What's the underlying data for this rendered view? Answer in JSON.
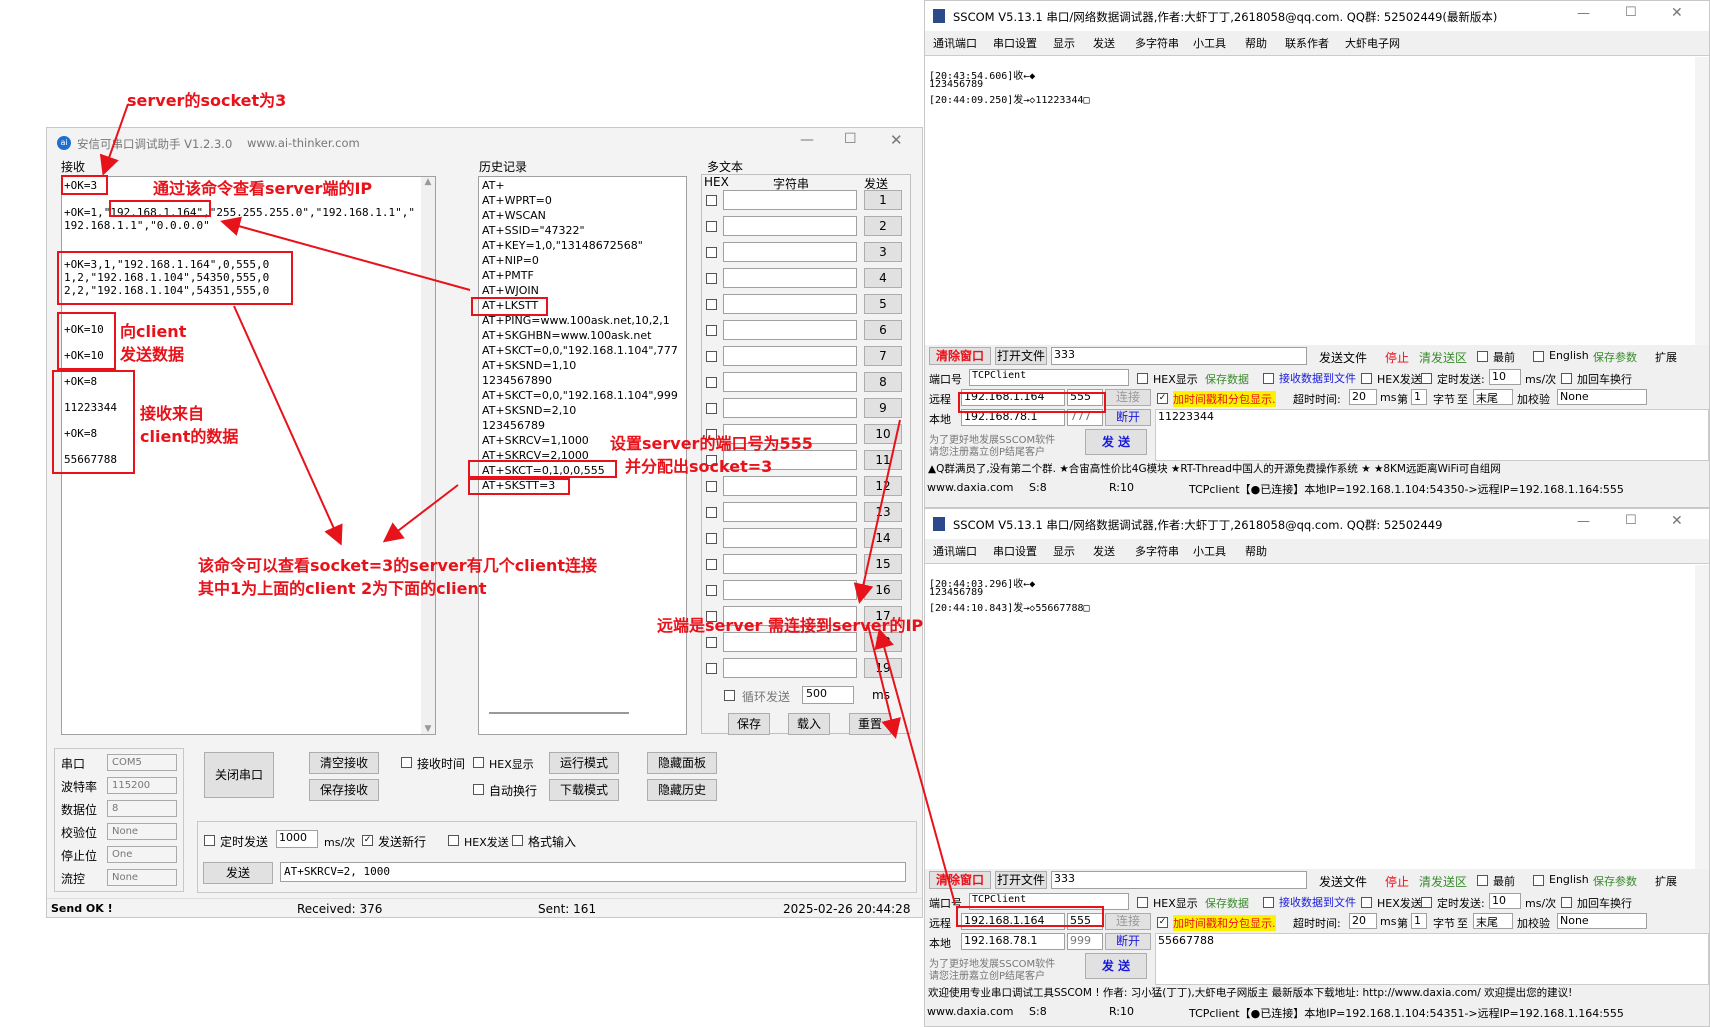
{
  "annotations": {
    "server_socket": "server的socket为3",
    "query_ip": "通过该命令查看server端的IP",
    "send_client_1": "向client",
    "send_client_2": "发送数据",
    "recv_client_1": "接收来自",
    "recv_client_2": "client的数据",
    "set_port_1": "设置server的端口号为555",
    "set_port_2": "并分配出socket=3",
    "lkstt_1": "该命令可以查看socket=3的server有几个client连接",
    "lkstt_2": "其中1为上面的client 2为下面的client",
    "remote_note": "远端是server 需连接到server的IP"
  },
  "aithinker": {
    "title": "安信可串口调试助手 V1.2.3.0",
    "url": "www.ai-thinker.com",
    "recv_label": "接收",
    "recv_lines": [
      "+OK=3",
      "+OK=1,\"192.168.1.164\",\"255.255.255.0\",\"192.168.1.1\",\"",
      "192.168.1.1\",\"0.0.0.0\"",
      "+OK=3,1,\"192.168.1.164\",0,555,0",
      "1,2,\"192.168.1.104\",54350,555,0",
      "2,2,\"192.168.1.104\",54351,555,0",
      "+OK=10",
      "+OK=10",
      "+OK=8",
      "11223344",
      "+OK=8",
      "55667788"
    ],
    "history_label": "历史记录",
    "history": [
      "AT+",
      "AT+WPRT=0",
      "AT+WSCAN",
      "AT+SSID=\"47322\"",
      "AT+KEY=1,0,\"13148672568\"",
      "AT+NIP=0",
      "AT+PMTF",
      "AT+WJOIN",
      "AT+LKSTT",
      "AT+PING=www.100ask.net,10,2,1",
      "AT+SKGHBN=www.100ask.net",
      "AT+SKCT=0,0,\"192.168.1.104\",777",
      "AT+SKSND=1,10",
      "1234567890",
      "AT+SKCT=0,0,\"192.168.1.104\",999",
      "AT+SKSND=2,10",
      "123456789",
      "AT+SKRCV=1,1000",
      "AT+SKRCV=2,1000",
      "AT+SKCT=0,1,0,0,555",
      "AT+SKSTT=3"
    ],
    "multi_label": "多文本",
    "hex_label": "HEX",
    "str_label": "字符串",
    "send_label": "发送",
    "multi_nums": [
      "1",
      "2",
      "3",
      "4",
      "5",
      "6",
      "7",
      "8",
      "9",
      "10",
      "11",
      "12",
      "13",
      "14",
      "15",
      "16",
      "17",
      "18",
      "19"
    ],
    "loop_label": "循环发送",
    "loop_value": "500",
    "ms_label": "ms",
    "save": "保存",
    "load": "载入",
    "reset": "重置",
    "port_label": "串口",
    "port_value": "COM5",
    "baud_label": "波特率",
    "baud_value": "115200",
    "data_label": "数据位",
    "data_value": "8",
    "parity_label": "校验位",
    "parity_value": "None",
    "stop_label": "停止位",
    "stop_value": "One",
    "flow_label": "流控",
    "flow_value": "None",
    "close_port": "关闭串口",
    "clear_recv": "清空接收",
    "save_recv": "保存接收",
    "recv_time": "接收时间",
    "hex_show": "HEX显示",
    "run_mode": "运行模式",
    "hide_panel": "隐藏面板",
    "auto_wrap": "自动换行",
    "dl_mode": "下载模式",
    "hide_history": "隐藏历史",
    "timed_send": "定时发送",
    "timed_value": "1000",
    "ms_per": "ms/次",
    "send_newline": "发送新行",
    "hex_send": "HEX发送",
    "fmt_input": "格式输入",
    "send_btn": "发送",
    "send_value": "AT+SKRCV=2, 1000",
    "status_send": "Send OK !",
    "status_recv": "Received: 376",
    "status_sent": "Sent: 161",
    "status_time": "2025-02-26 20:44:28"
  },
  "sscom1": {
    "title": "SSCOM V5.13.1 串口/网络数据调试器,作者:大虾丁丁,2618058@qq.com. QQ群: 52502449(最新版本)",
    "menu": [
      "通讯端口",
      "串口设置",
      "显示",
      "发送",
      "多字符串",
      "小工具",
      "帮助",
      "联系作者",
      "大虾电子网"
    ],
    "log": [
      "[20:43:54.606]收←◆",
      "123456789",
      "[20:44:09.250]发→◇11223344□"
    ],
    "send_text": "11223344",
    "remote_ip": "192.168.1.164",
    "remote_port": "555",
    "local_ip": "192.168.78.1",
    "local_port": "777",
    "connect": "连接",
    "disconnect": "断开",
    "ad": "▲Q群满员了,没有第二个群. ★合宙高性价比4G模块 ★RT-Thread中国人的开源免费操作系统 ★ ★8KM远距离WiFi可自组网",
    "status": [
      "www.daxia.com",
      "S:8",
      "R:10",
      "TCPclient【●已连接】本地IP=192.168.1.104:54350->远程IP=192.168.1.164:555"
    ]
  },
  "sscom2": {
    "title": "SSCOM V5.13.1 串口/网络数据调试器,作者:大虾丁丁,2618058@qq.com. QQ群: 52502449",
    "menu": [
      "通讯端口",
      "串口设置",
      "显示",
      "发送",
      "多字符串",
      "小工具",
      "帮助"
    ],
    "log": [
      "[20:44:03.296]收←◆",
      "123456789",
      "[20:44:10.843]发→◇55667788□"
    ],
    "send_text": "55667788",
    "remote_ip": "192.168.1.164",
    "remote_port": "555",
    "local_ip": "192.168.78.1",
    "local_port": "999",
    "connect": "连接",
    "disconnect": "断开",
    "ad": "欢迎使用专业串口调试工具SSCOM ! 作者: 习小猛(丁丁),大虾电子网版主 最新版本下载地址: http://www.daxia.com/ 欢迎提出您的建议!",
    "status": [
      "www.daxia.com",
      "S:8",
      "R:10",
      "TCPclient【●已连接】本地IP=192.168.1.104:54351->远程IP=192.168.1.164:555"
    ]
  },
  "sscom_common": {
    "clear": "清除窗口",
    "open_file": "打开文件",
    "file_value": "333",
    "send_file": "发送文件",
    "stop": "停止",
    "clear_send": "清发送区",
    "top": "最前",
    "english": "English",
    "save_param": "保存参数",
    "expand": "扩展",
    "port_no": "端口号",
    "port_type": "TCPClient",
    "hex_show": "HEX显示",
    "save_data": "保存数据",
    "recv_to_file": "接收数据到文件",
    "hex_send": "HEX发送",
    "timed_send": "定时发送:",
    "timed_value": "10",
    "ms_per": "ms/次",
    "add_cr": "加回车换行",
    "timestamp": "加时间戳和分包显示.",
    "timeout": "超时时间:",
    "timeout_value": "20",
    "ms": "ms",
    "nth": "第",
    "nth_value": "1",
    "byte": "字节",
    "to": "至",
    "tail": "末尾",
    "checksum": "加校验",
    "check_value": "None",
    "remote": "远程",
    "local": "本地",
    "ad_text_1": "为了更好地发展SSCOM软件",
    "ad_text_2": "请您注册嘉立创P结尾客户",
    "send": "发 送"
  },
  "colors": {
    "annotation": "#e8121b",
    "hint": "#3a8a2e",
    "link": "#1a1adc"
  }
}
